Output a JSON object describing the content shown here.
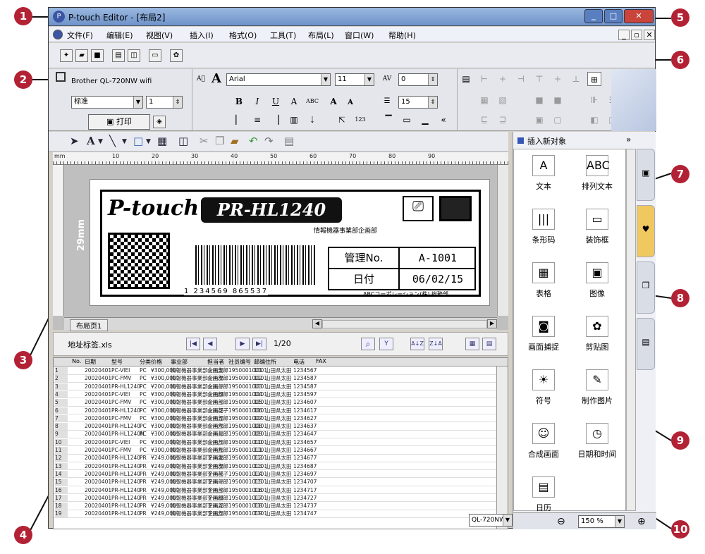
{
  "app": {
    "title": "P-touch Editor - [布局2]"
  },
  "menu": [
    "文件(F)",
    "编辑(E)",
    "视图(V)",
    "插入(I)",
    "格式(O)",
    "工具(T)",
    "布局(L)",
    "窗口(W)",
    "帮助(H)"
  ],
  "printer": {
    "name": "Brother QL-720NW wifi",
    "mode": "标准",
    "copies": "1",
    "print_label": "打印"
  },
  "font": {
    "family": "Arial",
    "size": "11",
    "spacing": "0",
    "line": "15"
  },
  "label": {
    "brand": "P-touch",
    "model": "PR-HL1240",
    "division": "情報機器事業部企画部",
    "mgmt_key": "管理No.",
    "mgmt_val": "A-1001",
    "date_key": "日付",
    "date_val": "06/02/15",
    "company": "ABCコーポレーション(株)  総務部",
    "barcode": "1 234569 865537",
    "width_tag": "29mm"
  },
  "ruler": [
    "mm",
    "10",
    "20",
    "30",
    "40",
    "50",
    "60",
    "70",
    "80",
    "90"
  ],
  "editor": {
    "tab": "布局页1"
  },
  "db": {
    "file": "地址标签.xls",
    "page": "1/20"
  },
  "grid": {
    "headers": [
      "No.",
      "日期",
      "型号",
      "分类",
      "价格",
      "事业部",
      "担当者",
      "社员编号",
      "邮编",
      "住所",
      "电话",
      "FAX"
    ],
    "rows": [
      [
        "1",
        "20020401",
        "PC-VIEI",
        "PC",
        "¥300,000",
        "情報機器事業部企画部",
        "山田太郎",
        "1950001001",
        "1101",
        "山田県太田",
        "1234567",
        ""
      ],
      [
        "2",
        "20020401",
        "PC-FMV",
        "PC",
        "¥300,000",
        "情報機器事業部企画部",
        "山田次郎",
        "1950001002",
        "1101",
        "山田県太田",
        "1234587",
        ""
      ],
      [
        "3",
        "20020401",
        "PR-HL1240",
        "PC",
        "¥200,000",
        "情報機器事業部企画部",
        "山田一郎",
        "1950001003",
        "1101",
        "山田県太田",
        "1234587",
        ""
      ],
      [
        "4",
        "20020401",
        "PC-VIEI",
        "PC",
        "¥300,000",
        "情報機器事業部企画部",
        "山田四郎",
        "1950001004",
        "1101",
        "山田県太田",
        "1234597",
        ""
      ],
      [
        "5",
        "20020401",
        "PC-FMV",
        "PC",
        "¥300,000",
        "情報機器事業部企画部",
        "山田三郎",
        "1950001005",
        "1101",
        "山田県太田",
        "1234607",
        ""
      ],
      [
        "6",
        "20020401",
        "PR-HL1240",
        "PC",
        "¥300,000",
        "情報機器事業部企画部",
        "山田花子",
        "1950001006",
        "1101",
        "山田県太田",
        "1234617",
        ""
      ],
      [
        "7",
        "20020401",
        "PC-FMV",
        "PC",
        "¥300,000",
        "情報機器事業部企画部",
        "山田五郎",
        "1950001007",
        "1101",
        "山田県太田",
        "1234627",
        ""
      ],
      [
        "8",
        "20020401",
        "PR-HL1240",
        "PC",
        "¥300,000",
        "情報機器事業部企画部",
        "山田六郎",
        "1950001008",
        "1101",
        "山田県太田",
        "1234637",
        ""
      ],
      [
        "9",
        "20020401",
        "PR-HL1240N",
        "PC",
        "¥300,000",
        "情報機器事業部企画部",
        "山田七郎",
        "1950001009",
        "1101",
        "山田県太田",
        "1234647",
        ""
      ],
      [
        "10",
        "20020401",
        "PC-VIEI",
        "PC",
        "¥300,000",
        "情報機器事業部企画部",
        "山田八郎",
        "1950001010",
        "1101",
        "山田県太田",
        "1234657",
        ""
      ],
      [
        "11",
        "20020401",
        "PC-FMV",
        "PC",
        "¥300,000",
        "情報機器事業部企画部",
        "山田九郎",
        "1950001011",
        "1101",
        "山田県太田",
        "1234667",
        ""
      ],
      [
        "12",
        "20020401",
        "PR-HL1240",
        "PR",
        "¥249,000",
        "情報機器事業部企画部",
        "下田太郎",
        "1950001012",
        "1101",
        "山田県太田",
        "1234677",
        ""
      ],
      [
        "13",
        "20020401",
        "PR-HL1240",
        "PR",
        "¥249,000",
        "情報機器事業部企画部",
        "下田次郎",
        "1950001013",
        "1101",
        "山田県太田",
        "1234687",
        ""
      ],
      [
        "14",
        "20020401",
        "PR-HL1240",
        "PR",
        "¥249,000",
        "情報機器事業部企画部",
        "下田花子",
        "1950001014",
        "1101",
        "山田県太田",
        "1234697",
        ""
      ],
      [
        "15",
        "20020401",
        "PR-HL1240",
        "PR",
        "¥249,000",
        "情報機器事業部企画部",
        "下田一郎",
        "1950001015",
        "1101",
        "山田県太田",
        "1234707",
        ""
      ],
      [
        "16",
        "20020401",
        "PR-HL1240",
        "PR",
        "¥249,000",
        "情報機器事業部企画部",
        "下田三郎",
        "1950001016",
        "1101",
        "山田県太田",
        "1234717",
        ""
      ],
      [
        "17",
        "20020401",
        "PR-HL1240",
        "PR",
        "¥249,000",
        "情報機器事業部企画部",
        "下田四郎",
        "1950001017",
        "1101",
        "山田県太田",
        "1234727",
        ""
      ],
      [
        "18",
        "20020401",
        "PR-HL1240",
        "PR",
        "¥249,000",
        "情報機器事業部企画部",
        "下田五郎",
        "1950001018",
        "1101",
        "山田県太田",
        "1234737",
        ""
      ],
      [
        "19",
        "20020401",
        "PR-HL1240",
        "PR",
        "¥249,000",
        "情報機器事業部企画部",
        "下田六郎",
        "1950001019",
        "1101",
        "山田県太田",
        "1234747",
        ""
      ]
    ]
  },
  "panel": {
    "header": "插入新对象",
    "items": [
      {
        "label": "文本",
        "icon": "A"
      },
      {
        "label": "排列文本",
        "icon": "ABC"
      },
      {
        "label": "条形码",
        "icon": "|||"
      },
      {
        "label": "装饰框",
        "icon": "▭"
      },
      {
        "label": "表格",
        "icon": "▦"
      },
      {
        "label": "图像",
        "icon": "▣"
      },
      {
        "label": "画面捕捉",
        "icon": "◙"
      },
      {
        "label": "剪贴图",
        "icon": "✿"
      },
      {
        "label": "符号",
        "icon": "☀"
      },
      {
        "label": "制作图片",
        "icon": "✎"
      },
      {
        "label": "合成画面",
        "icon": "☺"
      },
      {
        "label": "日期和时间",
        "icon": "◷"
      },
      {
        "label": "日历",
        "icon": "▤"
      }
    ]
  },
  "status": {
    "printer": "QL-720NW",
    "zoom": "150 %"
  },
  "callouts": [
    "1",
    "2",
    "3",
    "4",
    "5",
    "6",
    "7",
    "8",
    "9",
    "10"
  ],
  "colors": {
    "callout": "#b22234",
    "title": "#6f93c9",
    "panel_title": "#3556b5"
  }
}
